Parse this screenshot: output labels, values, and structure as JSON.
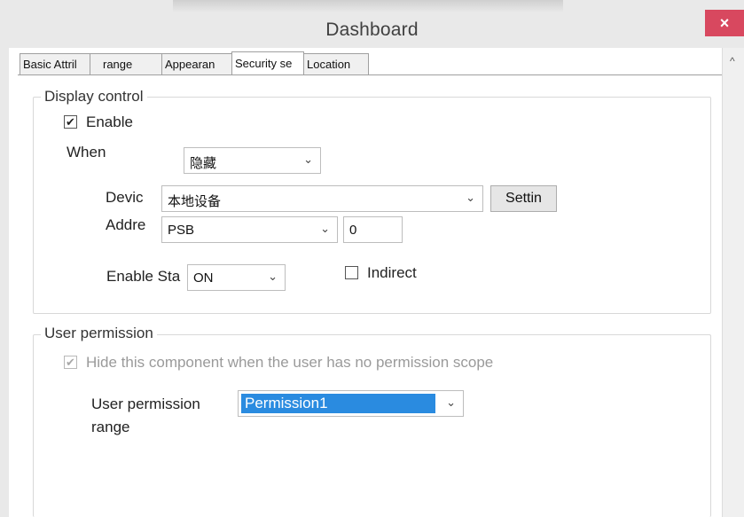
{
  "window": {
    "title": "Dashboard",
    "close_icon": "×"
  },
  "tabs": [
    {
      "label": "Basic Attril"
    },
    {
      "label": "range"
    },
    {
      "label": "Appearan"
    },
    {
      "label": "Security se"
    },
    {
      "label": "Location"
    }
  ],
  "display_control": {
    "group_title": "Display control",
    "enable_label": "Enable",
    "enable_checked": "✔",
    "when_label": "When",
    "when_value": "隐藏",
    "device_label": "Devic",
    "device_value": "本地设备",
    "settings_button": "Settin",
    "address_label": "Addre",
    "address_type": "PSB",
    "address_value": "0",
    "enable_state_label": "Enable Sta",
    "enable_state_value": "ON",
    "indirect_label": "Indirect"
  },
  "user_permission": {
    "group_title": "User permission",
    "hide_label": "Hide this component when the user has no permission scope",
    "hide_checked": "✔",
    "range_label_line1": "User permission",
    "range_label_line2": "range",
    "range_value": "Permission1"
  },
  "icons": {
    "chevron": "⌄",
    "scroll_up": "^"
  }
}
